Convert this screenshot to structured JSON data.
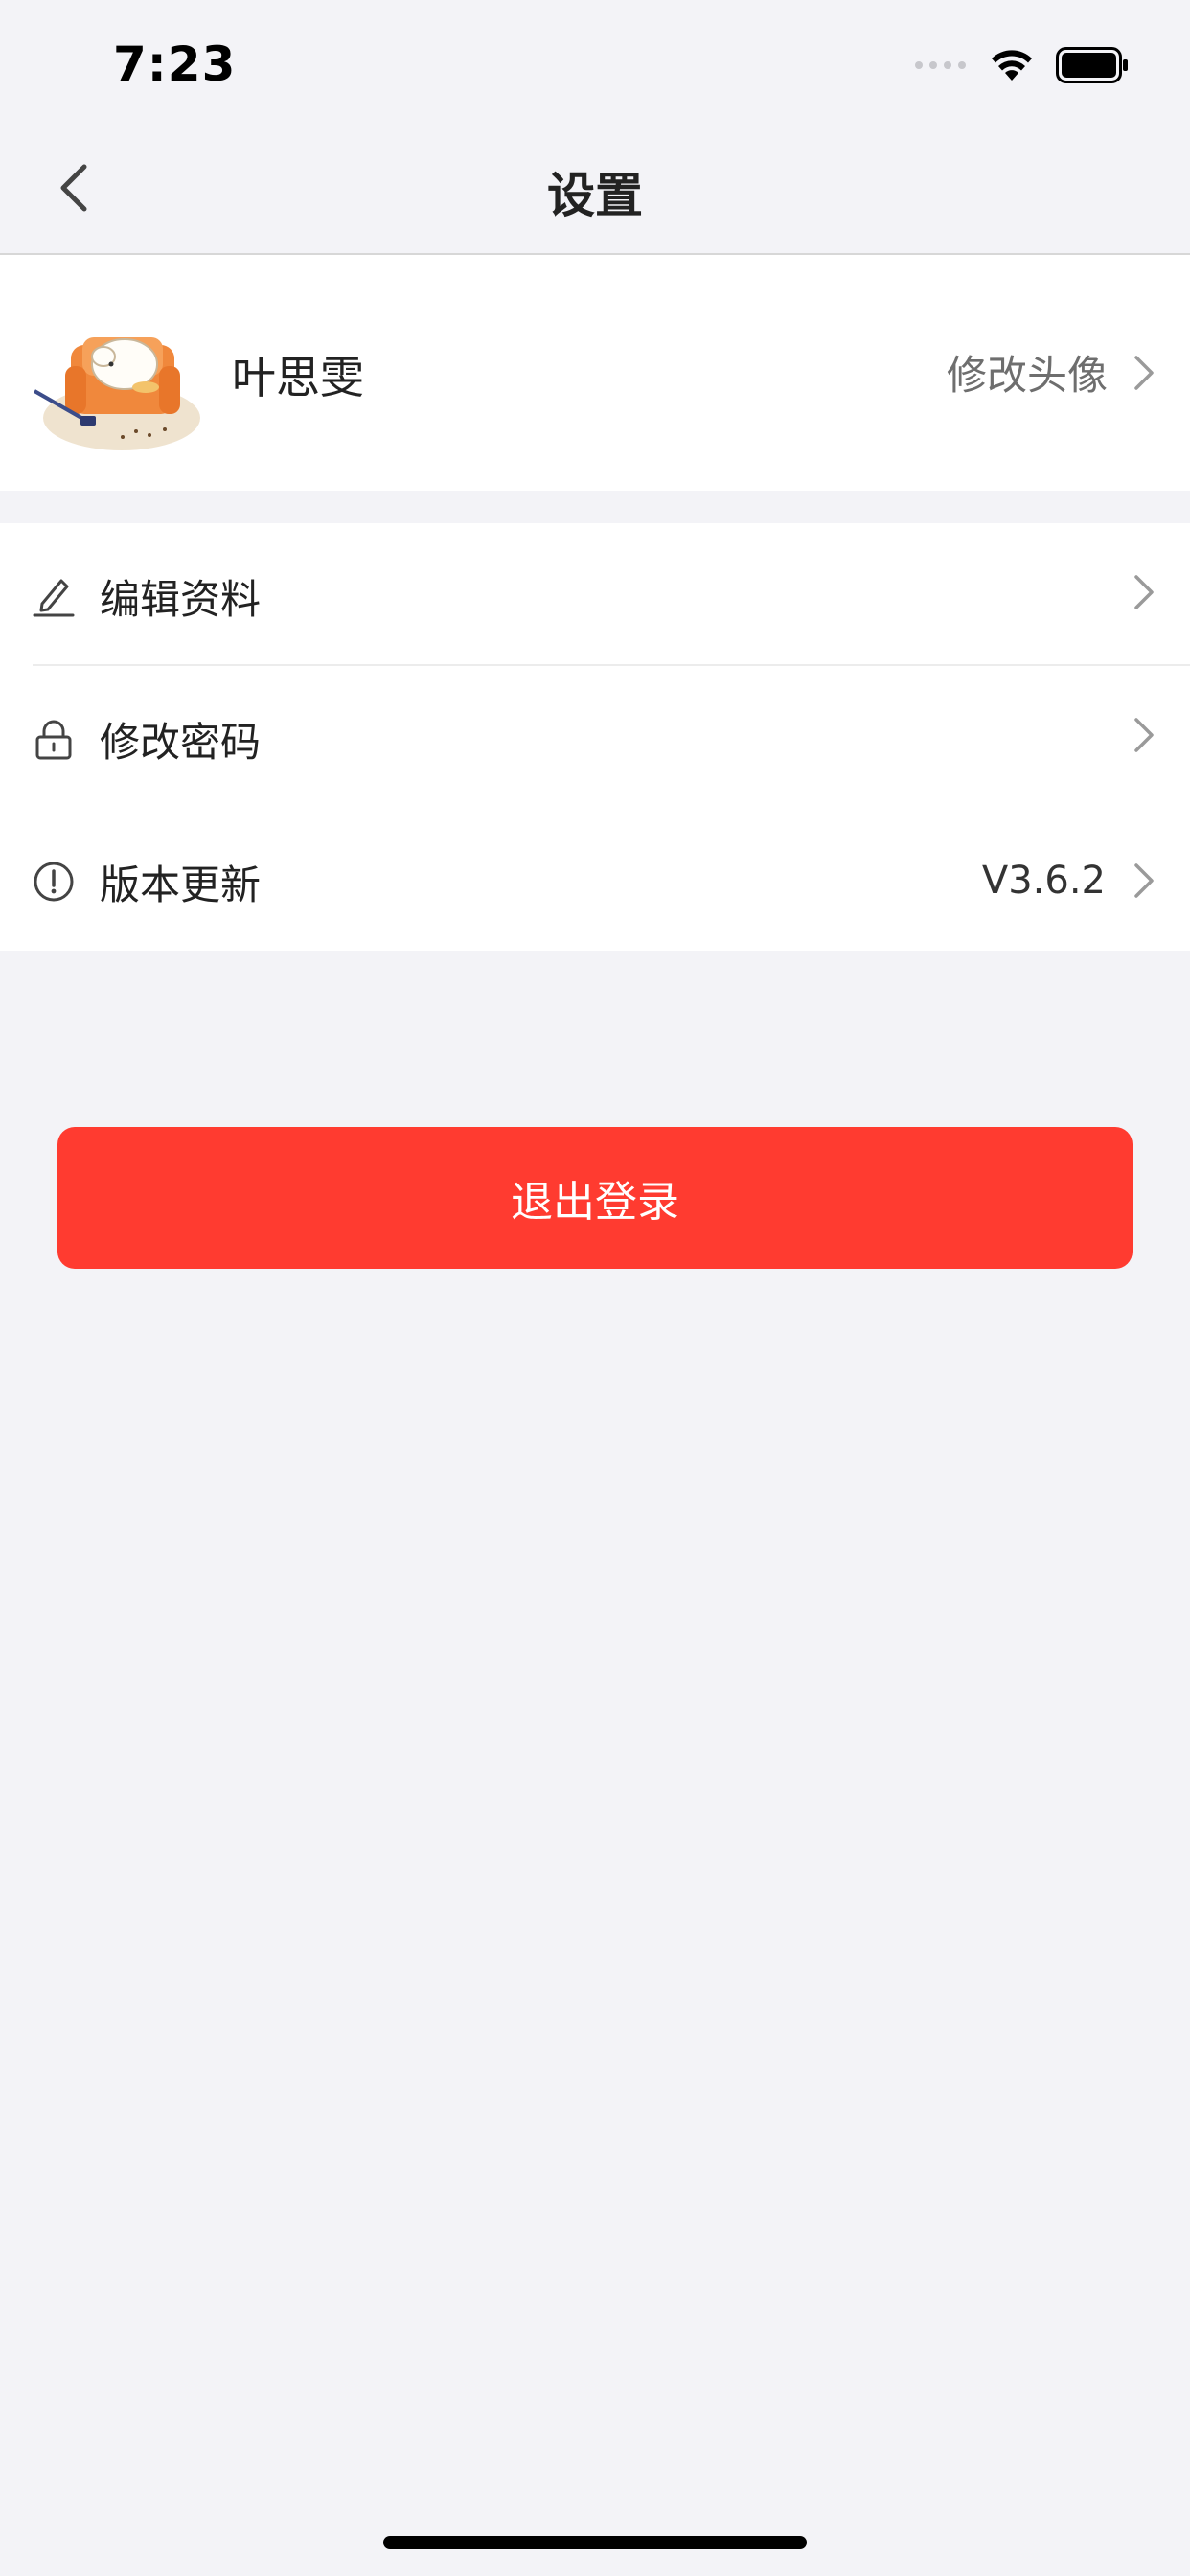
{
  "status_bar": {
    "time": "7:23"
  },
  "navbar": {
    "title": "设置"
  },
  "profile": {
    "name": "叶思雯",
    "change_avatar_label": "修改头像"
  },
  "menu": {
    "items": [
      {
        "label": "编辑资料",
        "icon": "edit-icon",
        "value": ""
      },
      {
        "label": "修改密码",
        "icon": "lock-icon",
        "value": ""
      },
      {
        "label": "版本更新",
        "icon": "info-icon",
        "value": "V3.6.2"
      }
    ]
  },
  "logout": {
    "label": "退出登录"
  },
  "colors": {
    "accent": "#ff3b30",
    "background": "#f3f3f7",
    "card": "#ffffff"
  }
}
